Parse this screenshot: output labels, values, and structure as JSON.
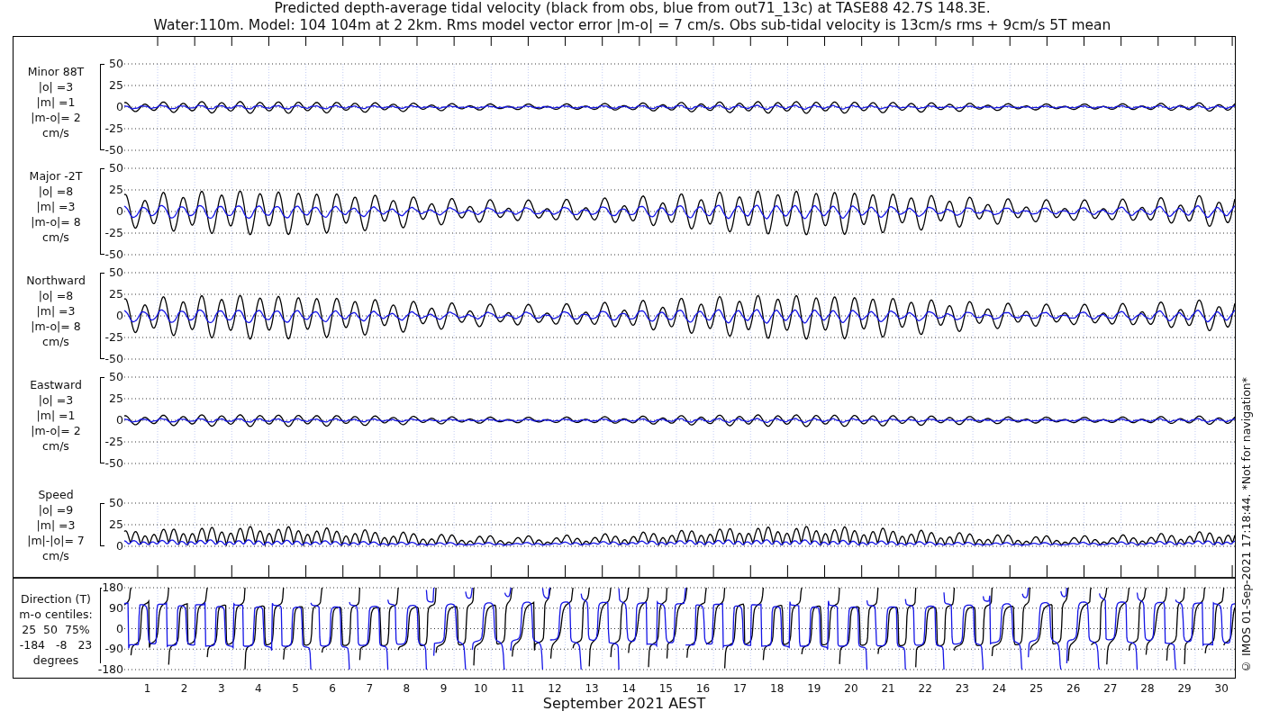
{
  "title_lines": [
    "Predicted depth-average tidal velocity (black from obs, blue from out71_13c) at TASE88 42.7S 148.3E.",
    "Water:110m. Model: 104 104m at 2 2km. Rms model vector error |m-o| = 7 cm/s. Obs sub-tidal velocity is 13cm/s rms + 9cm/s 5T mean"
  ],
  "panels": [
    {
      "kind": "velocity",
      "label_lines": [
        "Minor 88T",
        "|o| =3",
        "|m| =1",
        "|m-o|= 2",
        "cm/s"
      ],
      "yticks": [
        "50",
        "25",
        "0",
        "-25",
        "-50"
      ]
    },
    {
      "kind": "velocity",
      "label_lines": [
        "Major -2T",
        "|o| =8",
        "|m| =3",
        "|m-o|= 8",
        "cm/s"
      ],
      "yticks": [
        "50",
        "25",
        "0",
        "-25",
        "-50"
      ]
    },
    {
      "kind": "velocity",
      "label_lines": [
        "Northward",
        "|o| =8",
        "|m| =3",
        "|m-o|= 8",
        "cm/s"
      ],
      "yticks": [
        "50",
        "25",
        "0",
        "-25",
        "-50"
      ]
    },
    {
      "kind": "velocity",
      "label_lines": [
        "Eastward",
        "|o| =3",
        "|m| =1",
        "|m-o|= 2",
        "cm/s"
      ],
      "yticks": [
        "50",
        "25",
        "0",
        "-25",
        "-50"
      ]
    },
    {
      "kind": "speed",
      "label_lines": [
        "Speed",
        "|o| =9",
        "|m| =3",
        "|m|-|o|= 7",
        "cm/s"
      ],
      "yticks": [
        "50",
        "25",
        "0"
      ]
    },
    {
      "kind": "direction",
      "label_lines": [
        "Direction (T)",
        "m-o centiles:",
        "25  50  75%",
        "-184   -8   23",
        "degrees"
      ],
      "yticks": [
        "180",
        "90",
        "0",
        "-90",
        "-180"
      ]
    }
  ],
  "x_axis": {
    "ticks": [
      "1",
      "2",
      "3",
      "4",
      "5",
      "6",
      "7",
      "8",
      "9",
      "10",
      "11",
      "12",
      "13",
      "14",
      "15",
      "16",
      "17",
      "18",
      "19",
      "20",
      "21",
      "22",
      "23",
      "24",
      "25",
      "26",
      "27",
      "28",
      "29",
      "30"
    ],
    "label": "September 2021 AEST"
  },
  "side_note": "© IMOS 01-Sep-2021 17:18:44. *Not for navigation*"
}
